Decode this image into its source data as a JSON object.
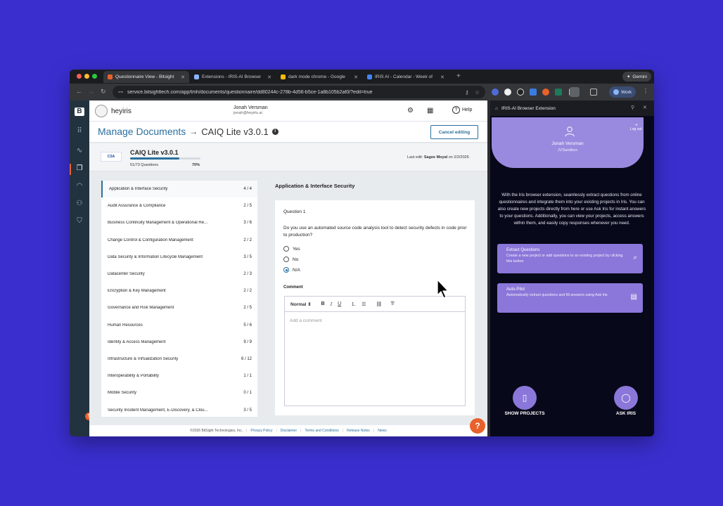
{
  "browser": {
    "tabs": [
      {
        "title": "Questionnaire View - Bitsight",
        "color": "#e8612b",
        "active": true
      },
      {
        "title": "Extensions - IRIS-AI Browser",
        "color": "#8ab4f8",
        "active": false
      },
      {
        "title": "dark mode chrome - Google",
        "color": "#fbbc04",
        "active": false
      },
      {
        "title": "IRIS AI - Calendar - Week of",
        "color": "#4285f4",
        "active": false
      }
    ],
    "gemini_label": "Gemini",
    "url": "service.bitsighttech.com/app/tmh/documents/questionnaire/dd80244c-278b-4d56-b5ce-1a8b105b2af0/?edit=true",
    "profile_label": "Work"
  },
  "header": {
    "brand": "heyiris",
    "user_name": "Jonah Versman",
    "user_email": "jonah@heyiris.ai",
    "help_label": "Help"
  },
  "titlebar": {
    "section": "Manage Documents",
    "document": "CAIQ Lite v3.0.1",
    "cancel_label": "Cancel editing"
  },
  "docinfo": {
    "logo_text": "CSA",
    "name": "CAIQ Lite v3.0.1",
    "questions": "51/73 Questions",
    "percent_label": "70%",
    "progress": 0.7,
    "last_edit_prefix": "Last edit:",
    "last_edit_user": "Sagee Moyal",
    "last_edit_date": "on 2/2/2026"
  },
  "sections": [
    {
      "name": "Application & Interface Security",
      "count": "4 / 4"
    },
    {
      "name": "Audit Assurance & Compliance",
      "count": "2 / 5"
    },
    {
      "name": "Business Continuity Management & Operational Re...",
      "count": "3 / 6"
    },
    {
      "name": "Change Control & Configuration Management",
      "count": "2 / 2"
    },
    {
      "name": "Data Security & Information Lifecycle Management",
      "count": "3 / 5"
    },
    {
      "name": "Datacenter Security",
      "count": "2 / 3"
    },
    {
      "name": "Encryption & Key Management",
      "count": "2 / 2"
    },
    {
      "name": "Governance and Risk Management",
      "count": "2 / 5"
    },
    {
      "name": "Human Resources",
      "count": "5 / 6"
    },
    {
      "name": "Identity & Access Management",
      "count": "9 / 9"
    },
    {
      "name": "Infrastructure & Virtualization Security",
      "count": "6 / 12"
    },
    {
      "name": "Interoperability & Portability",
      "count": "1 / 1"
    },
    {
      "name": "Mobile Security",
      "count": "0 / 1"
    },
    {
      "name": "Security Incident Management, E-Discovery, & Clou...",
      "count": "3 / 5"
    }
  ],
  "question": {
    "section_title": "Application & Interface Security",
    "number": "Question 1",
    "text": "Do you use an automated source code analysis tool to detect security defects in code prior to production?",
    "options": [
      "Yes",
      "No",
      "N/A"
    ],
    "selected": "N/A",
    "comment_label": "Comment",
    "editor_style": "Normal",
    "comment_placeholder": "Add a comment"
  },
  "footer": {
    "copyright": "©2026 BitSight Technologies, Inc.",
    "links": [
      "Privacy Policy",
      "Disclaimer",
      "Terms and Conditions",
      "Release Notes",
      "News"
    ]
  },
  "rail": {
    "badge": "5"
  },
  "extension": {
    "title": "IRIS-AI Browser Extension",
    "user_name": "Jonah Versman",
    "org": "JVSandbox",
    "logout_label": "Log out",
    "intro": "With the Iris browser extension, seamlessly extract questions from online questionnaires and integrate them into your existing projects in Iris. You can also create new projects directly from here or use Ask Iris for instant answers to your questions. Additionally, you can view your projects, access answers within them, and easily copy responses whenever you need.",
    "extract_title": "Extract Questions",
    "extract_desc": "Create a new project or add questions to an existing project by clicking this button",
    "autopilot_title": "Auto-Pilot",
    "autopilot_desc": "Automatically extract questions and fill answers using Ask Iris",
    "show_projects_label": "SHOW PROJECTS",
    "ask_iris_label": "ASK IRIS"
  },
  "colors": {
    "accent": "#2a6f9e",
    "brand_orange": "#e8612b",
    "iris_purple": "#8b77d9",
    "page_bg": "#3a2ecf"
  }
}
